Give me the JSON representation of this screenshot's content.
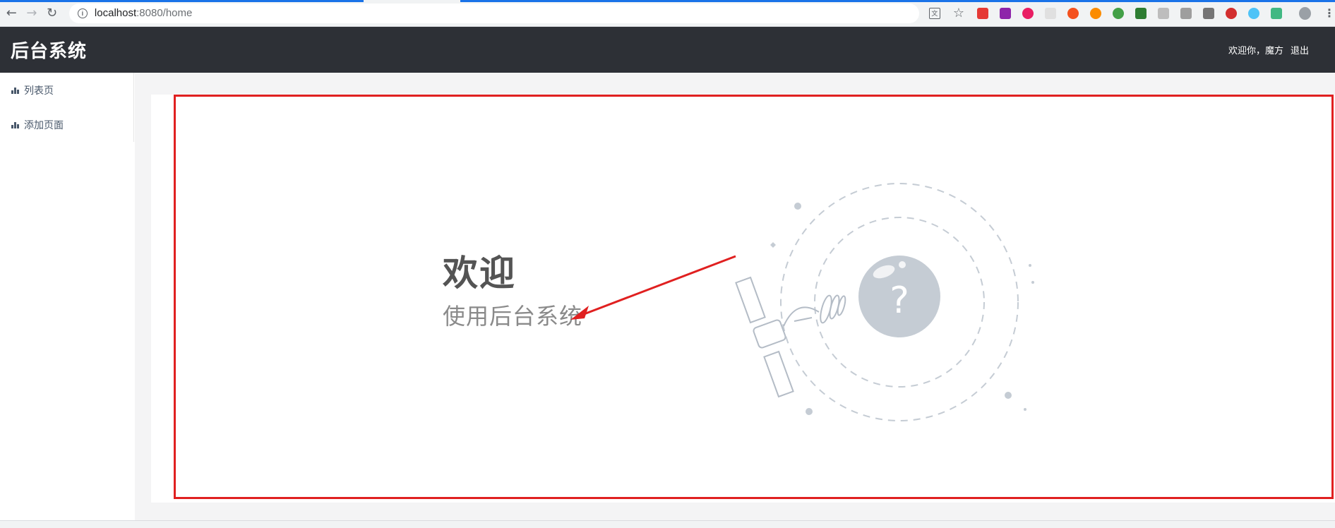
{
  "browser": {
    "url_host": "localhost",
    "url_path": ":8080/home"
  },
  "app": {
    "title": "后台系统",
    "welcome_user": "欢迎你，魔方",
    "logout_label": "退出"
  },
  "sidebar": {
    "items": [
      {
        "label": "列表页",
        "icon": "bar-chart-icon"
      },
      {
        "label": "添加页面",
        "icon": "bar-chart-icon"
      }
    ]
  },
  "main": {
    "welcome_title": "欢迎",
    "welcome_subtitle": "使用后台系统",
    "illustration_glyph": "?"
  },
  "colors": {
    "header_bg": "#2d3036",
    "highlight_border": "#e02020",
    "illustration": "#c5ccd4"
  }
}
